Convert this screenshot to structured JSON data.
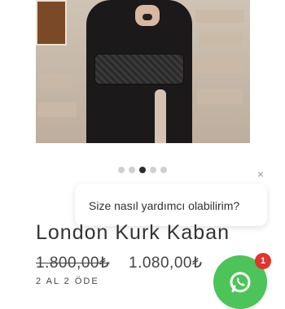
{
  "product": {
    "title": "London Kurk Kaban",
    "old_price": "1.800,00₺",
    "new_price": "1.080,00₺",
    "subline": "2 AL 2 ÖDE"
  },
  "carousel": {
    "dot_count": 5,
    "active_index": 2
  },
  "chat_popup": {
    "message": "Size nasıl yardımcı olabilirim?",
    "close_icon": "×"
  },
  "whatsapp": {
    "badge_count": "1",
    "color": "#4cc459",
    "badge_color": "#e0342c"
  }
}
